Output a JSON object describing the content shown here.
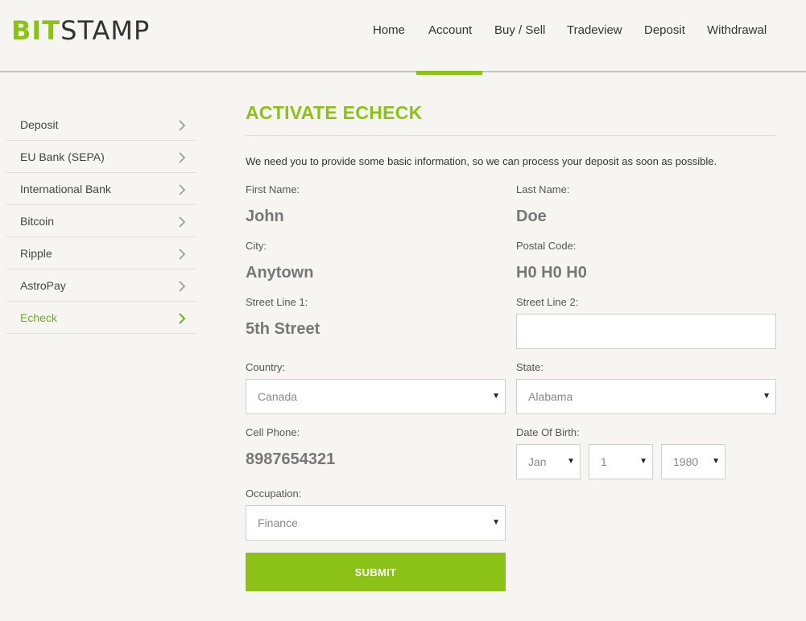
{
  "brand": {
    "logo_part1": "BIT",
    "logo_part2": "STAMP",
    "accent_color": "#8cc218"
  },
  "nav": {
    "items": [
      "Home",
      "Account",
      "Buy / Sell",
      "Tradeview",
      "Deposit",
      "Withdrawal"
    ],
    "active": "Account"
  },
  "sidebar": {
    "items": [
      {
        "label": "Deposit",
        "icon": "chevron-right-icon"
      },
      {
        "label": "EU Bank (SEPA)",
        "icon": "chevron-right-icon"
      },
      {
        "label": "International Bank",
        "icon": "chevron-right-icon"
      },
      {
        "label": "Bitcoin",
        "icon": "chevron-right-icon"
      },
      {
        "label": "Ripple",
        "icon": "chevron-right-icon"
      },
      {
        "label": "AstroPay",
        "icon": "chevron-right-icon"
      },
      {
        "label": "Echeck",
        "icon": "chevron-right-icon"
      }
    ],
    "active": "Echeck"
  },
  "main": {
    "title": "ACTIVATE ECHECK",
    "intro": "We need you to provide some basic information, so we can process your deposit as soon as possible.",
    "form": {
      "first_name": {
        "label": "First Name:",
        "value": "John"
      },
      "last_name": {
        "label": "Last Name:",
        "value": "Doe"
      },
      "city": {
        "label": "City:",
        "value": "Anytown"
      },
      "postal_code": {
        "label": "Postal Code:",
        "value": "H0 H0 H0"
      },
      "street1": {
        "label": "Street Line 1:",
        "value": "5th Street"
      },
      "street2": {
        "label": "Street Line 2:",
        "value": ""
      },
      "country": {
        "label": "Country:",
        "value": "Canada"
      },
      "state": {
        "label": "State:",
        "value": "Alabama"
      },
      "cell_phone": {
        "label": "Cell Phone:",
        "value": "8987654321"
      },
      "dob": {
        "label": "Date Of Birth:",
        "month": "Jan",
        "day": "1",
        "year": "1980"
      },
      "occupation": {
        "label": "Occupation:",
        "value": "Finance"
      },
      "submit_label": "SUBMIT"
    }
  }
}
